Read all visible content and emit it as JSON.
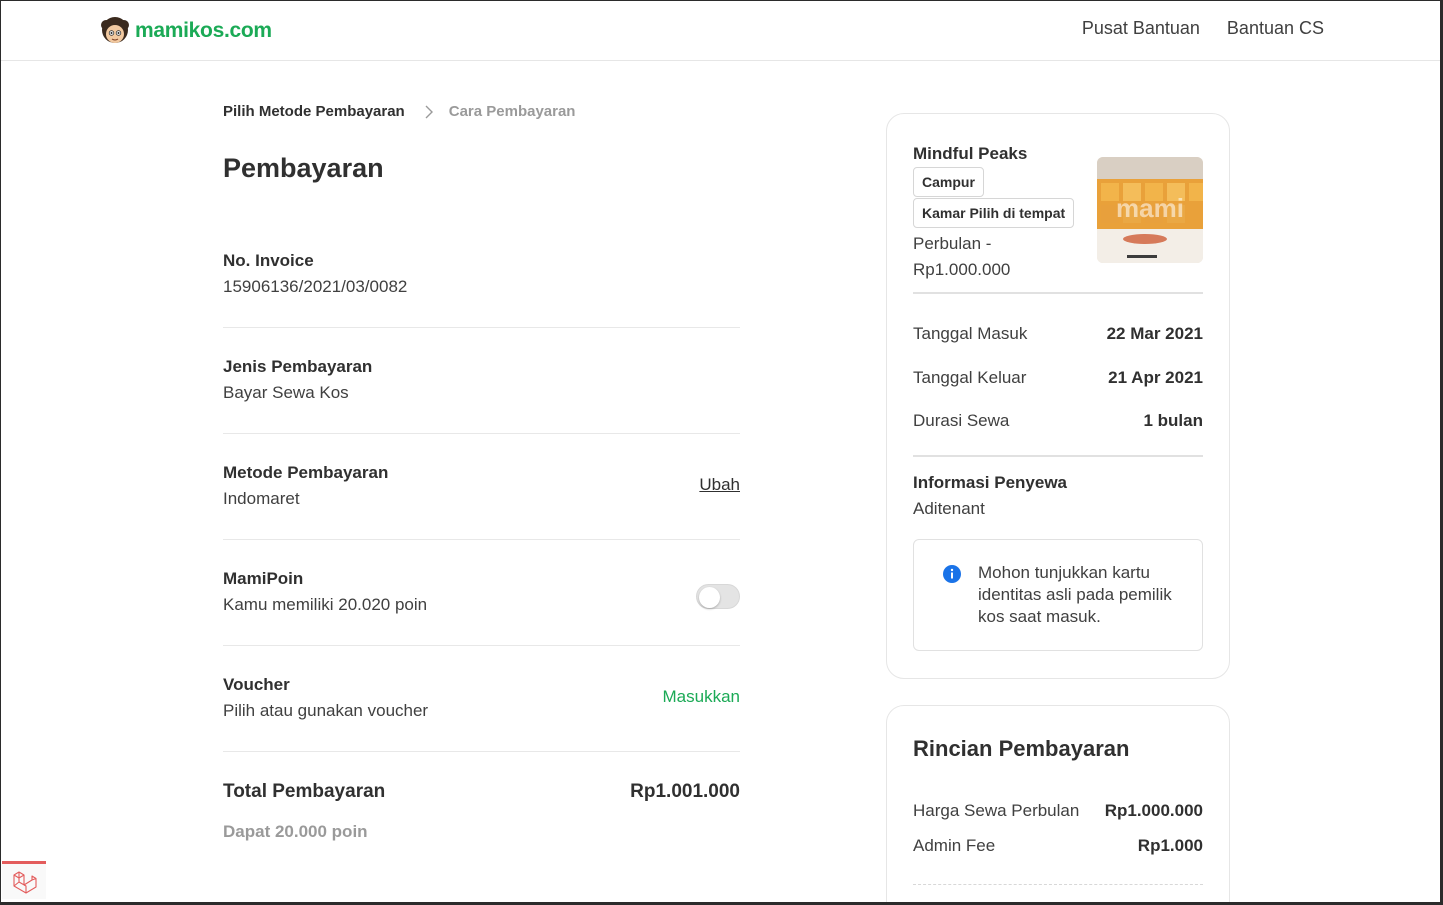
{
  "header": {
    "logo_text": "mamikos.com",
    "nav": [
      "Pusat Bantuan",
      "Bantuan CS"
    ]
  },
  "breadcrumb": {
    "step1": "Pilih Metode Pembayaran",
    "step2": "Cara Pembayaran"
  },
  "page_title": "Pembayaran",
  "details": {
    "invoice": {
      "label": "No. Invoice",
      "value": "15906136/2021/03/0082"
    },
    "payment_type": {
      "label": "Jenis Pembayaran",
      "value": "Bayar Sewa Kos"
    },
    "payment_method": {
      "label": "Metode Pembayaran",
      "value": "Indomaret",
      "action": "Ubah"
    },
    "mamipoin": {
      "label": "MamiPoin",
      "value": "Kamu memiliki 20.020 poin",
      "enabled": false
    },
    "voucher": {
      "label": "Voucher",
      "value": "Pilih atau gunakan voucher",
      "action": "Masukkan"
    }
  },
  "total": {
    "label": "Total Pembayaran",
    "amount": "Rp1.001.000",
    "points_note": "Dapat 20.000 poin"
  },
  "kos_card": {
    "name": "Mindful Peaks",
    "tags": [
      "Campur",
      "Kamar Pilih di tempat"
    ],
    "price": "Perbulan - Rp1.000.000",
    "check_in": {
      "label": "Tanggal Masuk",
      "value": "22 Mar 2021"
    },
    "check_out": {
      "label": "Tanggal Keluar",
      "value": "21 Apr 2021"
    },
    "duration": {
      "label": "Durasi Sewa",
      "value": "1 bulan"
    },
    "tenant": {
      "label": "Informasi Penyewa",
      "value": "Aditenant"
    },
    "notice": "Mohon tunjukkan kartu identitas asli pada pemilik kos saat masuk."
  },
  "rincian": {
    "title": "Rincian Pembayaran",
    "rows": [
      {
        "label": "Harga Sewa Perbulan",
        "value": "Rp1.000.000"
      },
      {
        "label": "Admin Fee",
        "value": "Rp1.000"
      }
    ]
  },
  "colors": {
    "brand_green": "#1baa56",
    "info_blue": "#1a73e8",
    "laravel_red": "#e35c5c"
  }
}
